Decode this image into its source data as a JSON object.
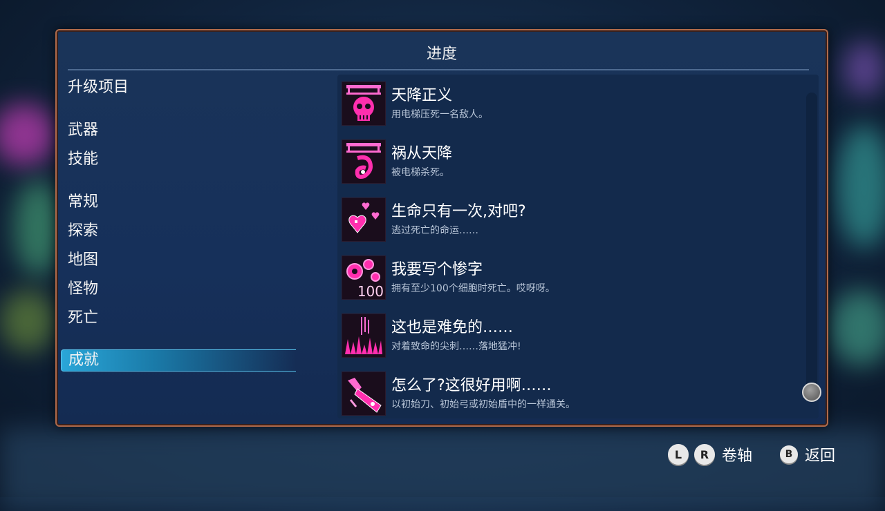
{
  "panel": {
    "title": "进度"
  },
  "categories": [
    {
      "label": "升级项目",
      "selected": false
    },
    {
      "label": "武器",
      "selected": false
    },
    {
      "label": "技能",
      "selected": false
    },
    {
      "label": "常规",
      "selected": false
    },
    {
      "label": "探索",
      "selected": false
    },
    {
      "label": "地图",
      "selected": false
    },
    {
      "label": "怪物",
      "selected": false
    },
    {
      "label": "死亡",
      "selected": false
    },
    {
      "label": "成就",
      "selected": true
    }
  ],
  "achievements": [
    {
      "title": "天降正义",
      "desc": "用电梯压死一名敌人。",
      "icon": "elevator-skull-icon"
    },
    {
      "title": "祸从天降",
      "desc": "被电梯杀死。",
      "icon": "elevator-crushed-icon"
    },
    {
      "title": "生命只有一次,对吧?",
      "desc": "逃过死亡的命运……",
      "icon": "hearts-icon"
    },
    {
      "title": "我要写个惨字",
      "desc": "拥有至少100个细胞时死亡。哎呀呀。",
      "icon": "cells-100-icon",
      "icon_text": "100"
    },
    {
      "title": "这也是难免的……",
      "desc": "对着致命的尖刺……落地猛冲!",
      "icon": "spikes-icon"
    },
    {
      "title": "怎么了?这很好用啊……",
      "desc": "以初始刀、初始弓或初始盾中的一样通关。",
      "icon": "starter-weapon-icon"
    }
  ],
  "hints": {
    "scroll_label": "卷轴",
    "back_label": "返回",
    "lb_glyph": "L",
    "rb_glyph": "R",
    "b_glyph": "B"
  },
  "colors": {
    "icon_glow": "#ff2fae",
    "selected_bg": "#2aa6d8",
    "panel_border": "#b06a4a"
  }
}
